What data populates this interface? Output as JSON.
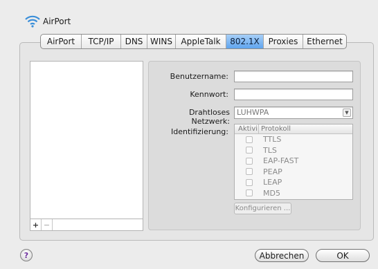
{
  "header": {
    "title": "AirPort",
    "icon": "wifi-icon"
  },
  "tabs": [
    {
      "label": "AirPort",
      "selected": false
    },
    {
      "label": "TCP/IP",
      "selected": false
    },
    {
      "label": "DNS",
      "selected": false
    },
    {
      "label": "WINS",
      "selected": false
    },
    {
      "label": "AppleTalk",
      "selected": false
    },
    {
      "label": "802.1X",
      "selected": true
    },
    {
      "label": "Proxies",
      "selected": false
    },
    {
      "label": "Ethernet",
      "selected": false
    }
  ],
  "list_controls": {
    "add": "+",
    "remove": "−"
  },
  "form": {
    "username_label": "Benutzername:",
    "username_value": "",
    "password_label": "Kennwort:",
    "password_value": "",
    "network_label": "Drahtloses Netzwerk:",
    "network_value": "LUHWPA",
    "auth_label": "Identifizierung:"
  },
  "auth_table": {
    "col_active": "Aktivi",
    "col_protocol": "Protokoll",
    "rows": [
      {
        "name": "TTLS",
        "checked": false
      },
      {
        "name": "TLS",
        "checked": false
      },
      {
        "name": "EAP-FAST",
        "checked": false
      },
      {
        "name": "PEAP",
        "checked": false
      },
      {
        "name": "LEAP",
        "checked": false
      },
      {
        "name": "MD5",
        "checked": false
      }
    ]
  },
  "configure_label": "Konfigurieren ...",
  "footer": {
    "help": "?",
    "cancel": "Abbrechen",
    "ok": "OK"
  },
  "colors": {
    "accent": "#5fa5ef",
    "wifi": "#3b8fd9"
  }
}
